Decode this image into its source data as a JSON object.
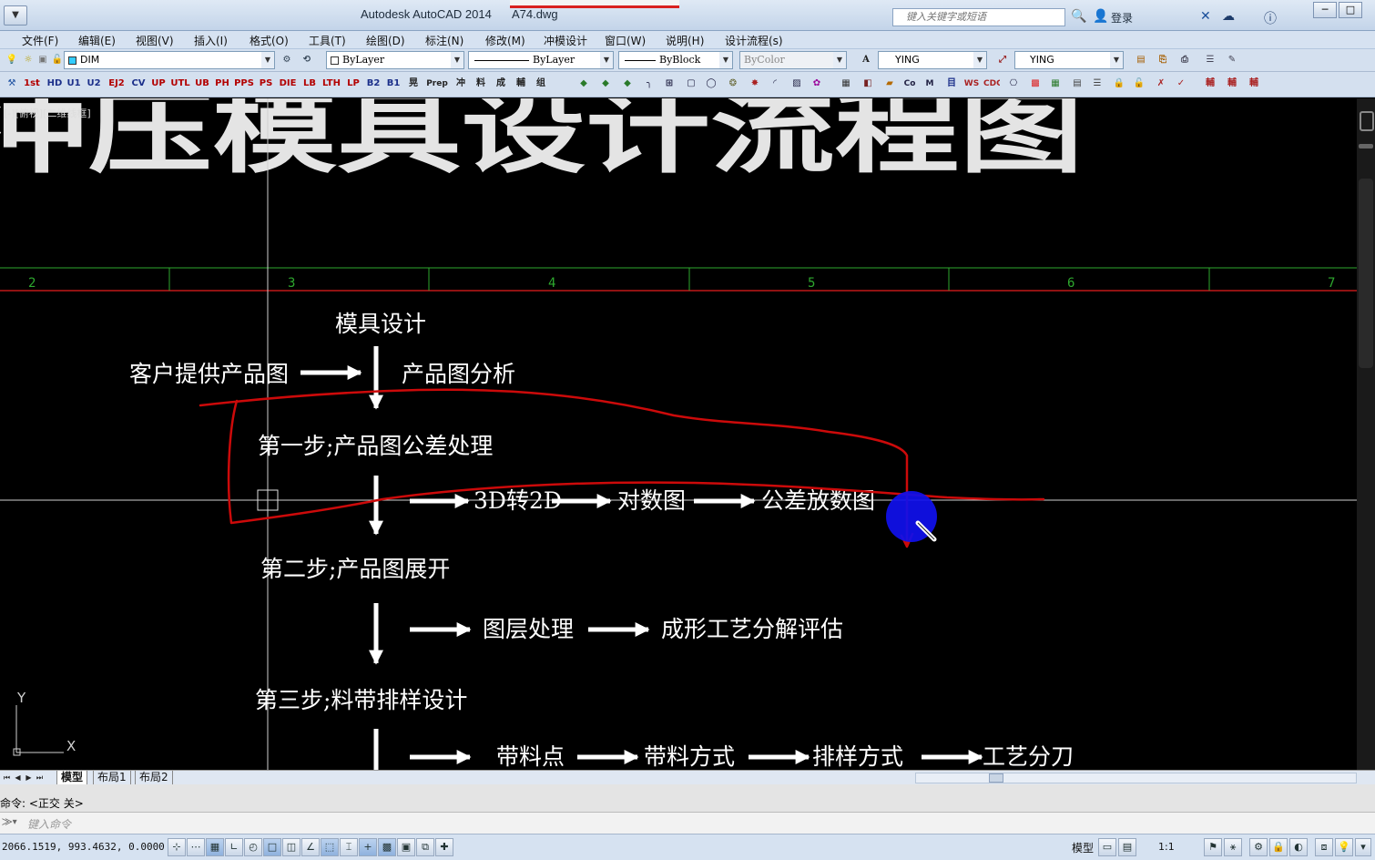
{
  "window": {
    "app_title": "Autodesk AutoCAD 2014",
    "file_title": "A74.dwg",
    "search_placeholder": "键入关键字或短语",
    "login_label": "登录"
  },
  "menu": {
    "items": [
      "文件(F)",
      "编辑(E)",
      "视图(V)",
      "插入(I)",
      "格式(O)",
      "工具(T)",
      "绘图(D)",
      "标注(N)",
      "修改(M)",
      "冲模设计",
      "窗口(W)",
      "说明(H)",
      "设计流程(s)"
    ]
  },
  "toolbar": {
    "layer_value": "DIM",
    "color_value": "ByLayer",
    "linetype_value": "ByLayer",
    "lineweight_value": "ByBlock",
    "plotstyle_value": "ByColor",
    "textstyle_value": "YING",
    "dimstyle_value": "YING",
    "row2_buttons": [
      "1st",
      "HD",
      "U1",
      "U2",
      "EJ2",
      "CV",
      "UP",
      "UTL",
      "UB",
      "PH",
      "PPS",
      "PS",
      "DIE",
      "LB",
      "LTH",
      "LP",
      "B2",
      "B1",
      "晃",
      "Prep",
      "冲",
      "料",
      "成",
      "輔",
      "组"
    ]
  },
  "viewport": {
    "label": "[-][俯视][二维线框]",
    "title_text": "冲压模具设计流程图",
    "ruler_numbers": [
      "2",
      "3",
      "4",
      "5",
      "6",
      "7"
    ],
    "ucs_x": "X",
    "ucs_y": "Y"
  },
  "flowchart": {
    "header": "模具设计",
    "input": "客户提供产品图",
    "analysis": "产品图分析",
    "step1": "第一步;产品图公差处理",
    "step1_items": [
      "3D转2D",
      "对数图",
      "公差放数图"
    ],
    "step2": "第二步;产品图展开",
    "step2_items": [
      "图层处理",
      "成形工艺分解评估"
    ],
    "step3": "第三步;料带排样设计",
    "step3_items": [
      "带料点",
      "带料方式",
      "排样方式",
      "工艺分刀"
    ]
  },
  "annotation": {
    "freehand_color": "#cc0a0a",
    "cursor_color": "#1010ee"
  },
  "tabs": {
    "items": [
      "模型",
      "布局1",
      "布局2"
    ],
    "active": "模型"
  },
  "command": {
    "history_line": "命令: <正交 关>",
    "input_placeholder": "键入命令"
  },
  "status": {
    "coordinates": "2066.1519, 993.4632, 0.0000",
    "model_label": "模型",
    "annotation_scale": "1:1"
  },
  "colors": {
    "canvas_bg": "#000000",
    "ruler_green": "#2ea82e",
    "ruler_red": "#c01818",
    "ui_blue": "#d6e2f1"
  }
}
